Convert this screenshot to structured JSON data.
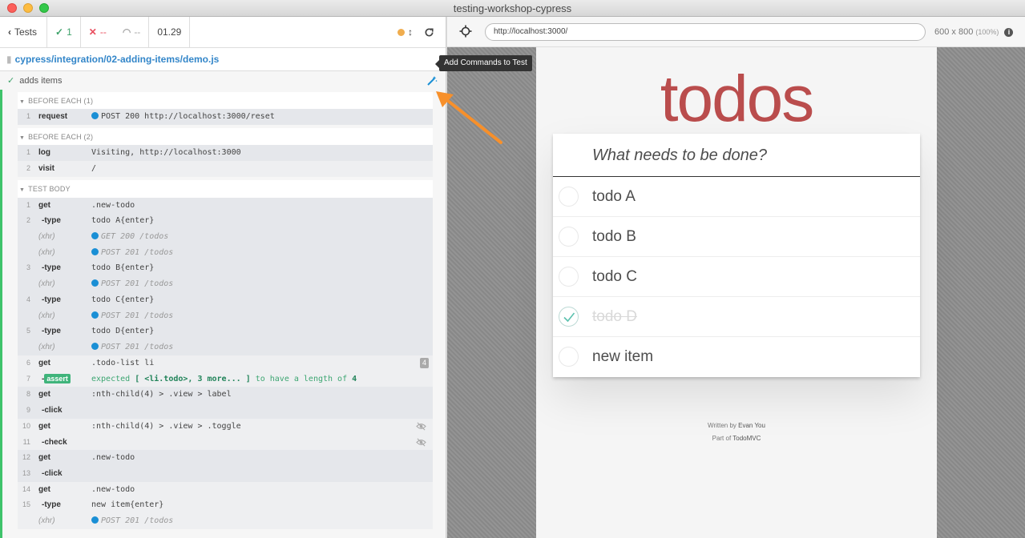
{
  "window": {
    "title": "testing-workshop-cypress"
  },
  "stats": {
    "tests_label": "Tests",
    "passed": "1",
    "failed": "--",
    "pending": "--",
    "duration": "01.29"
  },
  "spec": {
    "path": "cypress/integration/02-adding-items/demo.js"
  },
  "test": {
    "title": "adds items",
    "tooltip": "Add Commands to Test"
  },
  "hooks": {
    "before_each_1": "BEFORE EACH (1)",
    "before_each_2": "BEFORE EACH (2)",
    "test_body": "TEST BODY"
  },
  "commands": {
    "h1_1": {
      "num": "1",
      "name": "request",
      "msg": "POST 200 http://localhost:3000/reset"
    },
    "h2_1": {
      "num": "1",
      "name": "log",
      "msg": "Visiting, http://localhost:3000"
    },
    "h2_2": {
      "num": "2",
      "name": "visit",
      "msg": "/"
    },
    "b1": {
      "num": "1",
      "name": "get",
      "msg": ".new-todo"
    },
    "b2": {
      "num": "2",
      "name": "-type",
      "msg": "todo A{enter}"
    },
    "x1": {
      "name": "(xhr)",
      "msg": "GET 200 /todos"
    },
    "x2": {
      "name": "(xhr)",
      "msg": "POST 201 /todos"
    },
    "b3": {
      "num": "3",
      "name": "-type",
      "msg": "todo B{enter}"
    },
    "x3": {
      "name": "(xhr)",
      "msg": "POST 201 /todos"
    },
    "b4": {
      "num": "4",
      "name": "-type",
      "msg": "todo C{enter}"
    },
    "x4": {
      "name": "(xhr)",
      "msg": "POST 201 /todos"
    },
    "b5": {
      "num": "5",
      "name": "-type",
      "msg": "todo D{enter}"
    },
    "x5": {
      "name": "(xhr)",
      "msg": "POST 201 /todos"
    },
    "b6": {
      "num": "6",
      "name": "get",
      "msg": ".todo-list li",
      "badge": "4"
    },
    "b7": {
      "num": "7",
      "name_prefix": "-",
      "badge_label": "assert",
      "msg_pre": "expected ",
      "msg_b1": "[ <li.todo>, 3 more... ]",
      "msg_mid": " to have a length of ",
      "msg_b2": "4"
    },
    "b8": {
      "num": "8",
      "name": "get",
      "msg": ":nth-child(4) > .view > label"
    },
    "b9": {
      "num": "9",
      "name": "-click",
      "msg": ""
    },
    "b10": {
      "num": "10",
      "name": "get",
      "msg": ":nth-child(4) > .view > .toggle"
    },
    "b11": {
      "num": "11",
      "name": "-check",
      "msg": ""
    },
    "b12": {
      "num": "12",
      "name": "get",
      "msg": ".new-todo"
    },
    "b13": {
      "num": "13",
      "name": "-click",
      "msg": ""
    },
    "b14": {
      "num": "14",
      "name": "get",
      "msg": ".new-todo"
    },
    "b15": {
      "num": "15",
      "name": "-type",
      "msg": "new item{enter}"
    },
    "x6": {
      "name": "(xhr)",
      "msg": "POST 201 /todos"
    }
  },
  "browser": {
    "url": "http://localhost:3000/",
    "viewport": "600 x 800",
    "zoom": "(100%)"
  },
  "app": {
    "title": "todos",
    "placeholder": "What needs to be done?",
    "items": [
      {
        "label": "todo A",
        "completed": false
      },
      {
        "label": "todo B",
        "completed": false
      },
      {
        "label": "todo C",
        "completed": false
      },
      {
        "label": "todo D",
        "completed": true
      },
      {
        "label": "new item",
        "completed": false
      }
    ],
    "footer": {
      "written_by": "Written by",
      "author": "Evan You",
      "part_of": "Part of",
      "project": "TodoMVC"
    }
  },
  "colors": {
    "pass": "#3fa36b",
    "fail": "#e94f5f",
    "xhr_dot": "#1a8fd5",
    "todos_red": "#af2f2f",
    "arrow": "#f7902b"
  }
}
